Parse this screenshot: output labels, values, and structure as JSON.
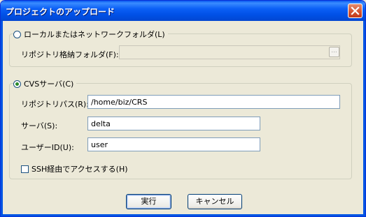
{
  "window": {
    "title": "プロジェクトのアップロード"
  },
  "local_group": {
    "radio_label": "ローカルまたはネットワークフォルダ(L)",
    "folder_label": "リポジトリ格納フォルダ(F):",
    "folder_value": "",
    "browse_label": "..."
  },
  "cvs_group": {
    "radio_label": "CVSサーバ(C)",
    "path_label": "リポジトリパス(R):",
    "path_value": "/home/biz/CRS",
    "server_label": "サーバ(S):",
    "server_value": "delta",
    "user_label": "ユーザーID(U):",
    "user_value": "user",
    "ssh_label": "SSH経由でアクセスする(H)"
  },
  "buttons": {
    "execute": "実行",
    "cancel": "キャンセル"
  }
}
